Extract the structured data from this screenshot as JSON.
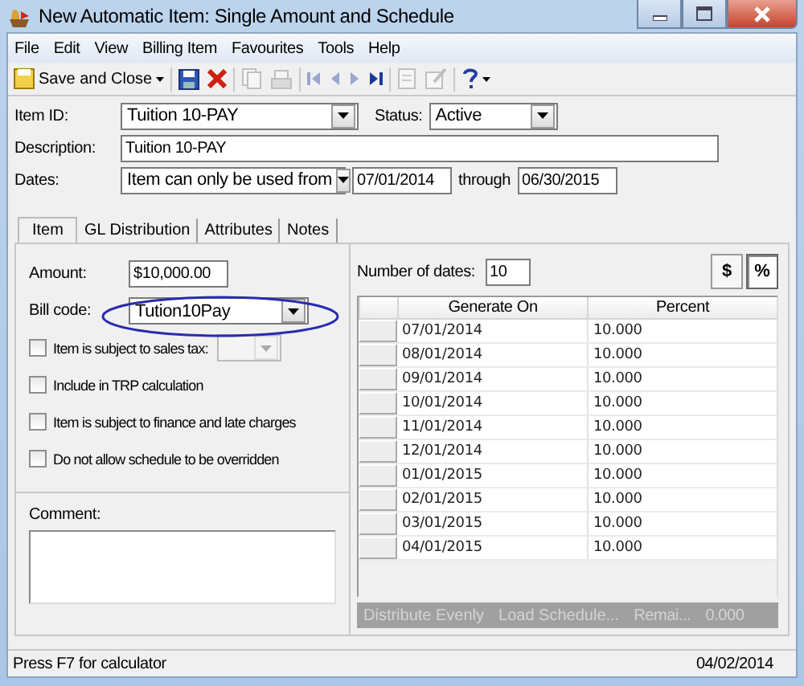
{
  "window": {
    "title": "New Automatic Item: Single Amount and Schedule"
  },
  "menu": [
    "File",
    "Edit",
    "View",
    "Billing Item",
    "Favourites",
    "Tools",
    "Help"
  ],
  "toolbar": [
    {
      "kind": "save_close",
      "label": "Save and Close",
      "disabled": false
    },
    {
      "kind": "save",
      "disabled": false
    },
    {
      "kind": "delete",
      "disabled": false
    },
    {
      "kind": "copy",
      "disabled": true
    },
    {
      "kind": "print",
      "disabled": true
    },
    {
      "kind": "first",
      "disabled": true
    },
    {
      "kind": "previous",
      "disabled": true
    },
    {
      "kind": "next",
      "disabled": true
    },
    {
      "kind": "last",
      "disabled": false
    },
    {
      "kind": "page",
      "disabled": true
    },
    {
      "kind": "edit",
      "disabled": true
    },
    {
      "kind": "help",
      "disabled": false
    }
  ],
  "fields": {
    "item_id": {
      "label": "Item ID:",
      "value": "Tuition 10-PAY"
    },
    "status": {
      "label": "Status:",
      "value": "Active"
    },
    "description": {
      "label": "Description:",
      "value": "Tuition 10-PAY"
    },
    "dates": {
      "label": "Dates:",
      "mode": "Item can only be used from",
      "from": "07/01/2014",
      "through_label": "through",
      "to": "06/30/2015"
    }
  },
  "tabs": [
    {
      "label": "Item",
      "selected": true
    },
    {
      "label": "GL Distribution",
      "selected": false
    },
    {
      "label": "Attributes",
      "selected": false
    },
    {
      "label": "Notes",
      "selected": false
    }
  ],
  "item_tab": {
    "amount": {
      "label": "Amount:",
      "value": "$10,000.00"
    },
    "bill_code": {
      "label": "Bill code:",
      "value": "Tution10Pay",
      "highlighted": true
    },
    "options": [
      {
        "kind": "with_tax_code",
        "label": "Item is subject to sales tax:",
        "checked": false
      },
      {
        "kind": "plain",
        "label": "Include in TRP calculation",
        "checked": false
      },
      {
        "kind": "plain",
        "label": "Item is subject to finance and late charges",
        "checked": false
      },
      {
        "kind": "plain",
        "label": "Do not allow schedule to be overridden",
        "checked": false
      }
    ],
    "comment": {
      "label": "Comment:"
    }
  },
  "schedule": {
    "count_label": "Number of dates:",
    "count": "10",
    "modes": [
      {
        "label": "$",
        "selected": false
      },
      {
        "label": "%",
        "selected": true
      }
    ],
    "columns": [
      "Generate On",
      "Percent"
    ],
    "rows": [
      {
        "date": "07/01/2014",
        "percent": "10.000"
      },
      {
        "date": "08/01/2014",
        "percent": "10.000"
      },
      {
        "date": "09/01/2014",
        "percent": "10.000"
      },
      {
        "date": "10/01/2014",
        "percent": "10.000"
      },
      {
        "date": "11/01/2014",
        "percent": "10.000"
      },
      {
        "date": "12/01/2014",
        "percent": "10.000"
      },
      {
        "date": "01/01/2015",
        "percent": "10.000"
      },
      {
        "date": "02/01/2015",
        "percent": "10.000"
      },
      {
        "date": "03/01/2015",
        "percent": "10.000"
      },
      {
        "date": "04/01/2015",
        "percent": "10.000"
      }
    ],
    "actions": [
      "Distribute Evenly",
      "Load Schedule..."
    ],
    "remaining_label": "Remai...",
    "remaining": "0.000"
  },
  "status_bar": {
    "hint": "Press F7 for calculator",
    "date": "04/02/2014"
  }
}
